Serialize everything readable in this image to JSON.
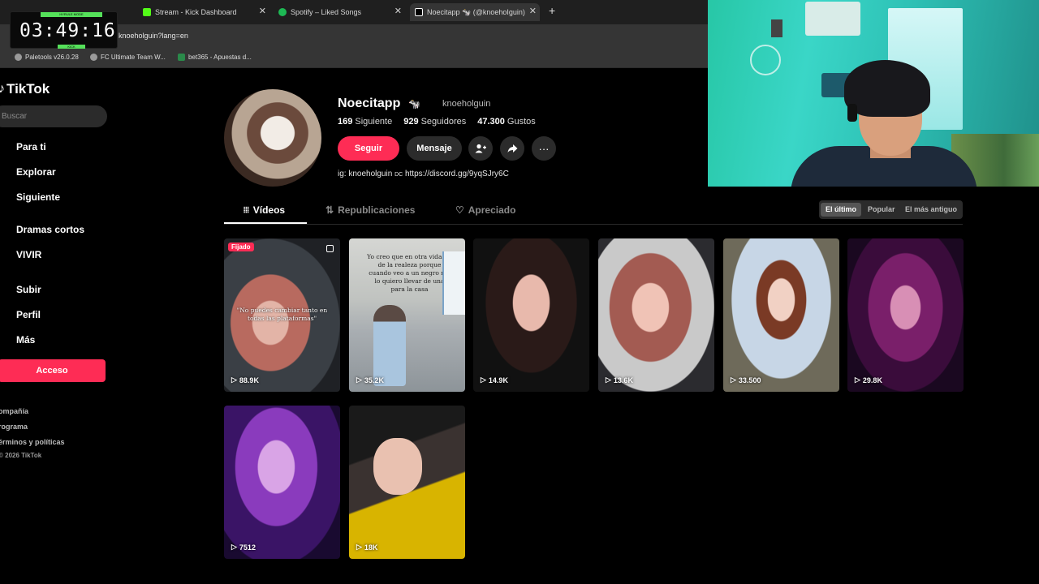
{
  "browser": {
    "tabs": [
      {
        "label": "Stream - Kick Dashboard",
        "favicon_color": "#53fc18"
      },
      {
        "label": "Spotify – Liked Songs",
        "favicon_color": "#1db954"
      },
      {
        "label": "Noecitapp 🐄 (@knoehoIguin)",
        "favicon_color": "#ffffff"
      }
    ],
    "url": "knoeholguin?lang=en",
    "bookmarks": [
      "Paletools v26.0.28",
      "FC Ultimate Team W...",
      "bet365 - Apuestas d..."
    ]
  },
  "timer": {
    "time": "03:49:16",
    "top_label": "HYRULE MODE",
    "bottom_label": "KICK"
  },
  "sidebar": {
    "logo": "TikTok",
    "search_placeholder": "Buscar",
    "nav": [
      "Para ti",
      "Explorar",
      "Siguiente",
      "Dramas cortos",
      "VIVIR",
      "Subir",
      "Perfil",
      "Más"
    ],
    "login": "Acceso",
    "footer_links": [
      "ompañía",
      "rograma",
      "érminos y políticas"
    ],
    "copyright": "© 2026 TikTok"
  },
  "profile": {
    "name": "Noecitapp",
    "name_emoji": "🐄",
    "handle": "knoeholguin",
    "following_count": "169",
    "following_label": "Siguiente",
    "followers_count": "929",
    "followers_label": "Seguidores",
    "likes_count": "47.300",
    "likes_label": "Gustos",
    "follow_button": "Seguir",
    "message_button": "Mensaje",
    "bio_prefix": "ig: knoeholguin",
    "bio_small": "DC",
    "bio_link": "https://discord.gg/9yqSJry6C"
  },
  "tabs": {
    "videos": "Vídeos",
    "reposts": "Republicaciones",
    "liked": "Apreciado"
  },
  "sort": {
    "latest": "El último",
    "popular": "Popular",
    "oldest": "El más antiguo"
  },
  "videos": [
    {
      "views": "88.9K",
      "badge": "Fijado",
      "caption": "\"No puedes cambiar tanto en todas las plataformas\""
    },
    {
      "views": "35.2K",
      "caption": "Yo creo que en otra vida fui de la realeza porque cuando veo a un negro me lo quiero llevar de una para la casa"
    },
    {
      "views": "14.9K"
    },
    {
      "views": "13.6K"
    },
    {
      "views": "33.500"
    },
    {
      "views": "29.8K"
    },
    {
      "views": "7512"
    },
    {
      "views": "18K"
    }
  ],
  "colors": {
    "accent": "#fe2c55",
    "background": "#000000",
    "kick_green": "#53fc18"
  }
}
